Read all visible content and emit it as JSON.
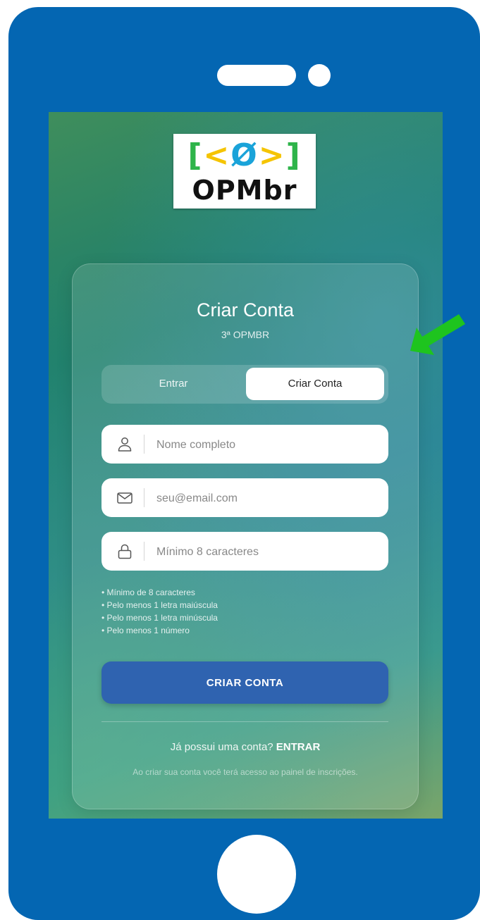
{
  "logo": {
    "bracket_left": "[",
    "angle_left": "<",
    "symbol": "Ø",
    "angle_right": ">",
    "bracket_right": "]",
    "wordmark": "OPMbr"
  },
  "card": {
    "title": "Criar Conta",
    "subtitle": "3ª OPMBR"
  },
  "tabs": {
    "login": "Entrar",
    "signup": "Criar Conta",
    "active": "signup"
  },
  "form": {
    "name_placeholder": "Nome completo",
    "email_placeholder": "seu@email.com",
    "password_placeholder": "Mínimo 8 caracteres",
    "name_value": "",
    "email_value": "",
    "password_value": ""
  },
  "password_rules": [
    "Mínimo de 8 caracteres",
    "Pelo menos 1 letra maiúscula",
    "Pelo menos 1 letra minúscula",
    "Pelo menos 1 número"
  ],
  "submit_label": "CRIAR CONTA",
  "login_prompt": {
    "text": "Já possui uma conta?",
    "link": "ENTRAR"
  },
  "footer_note": "Ao criar sua conta você terá acesso ao painel de inscrições.",
  "colors": {
    "phone_frame": "#0466b2",
    "primary_button": "#2f63b0",
    "arrow": "#1ec41e",
    "logo_green": "#2eb44a",
    "logo_yellow": "#f5c400",
    "logo_blue": "#1aa3d9"
  }
}
